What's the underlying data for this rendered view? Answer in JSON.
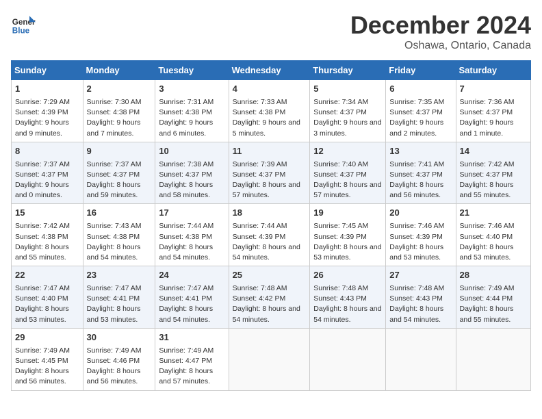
{
  "header": {
    "logo_line1": "General",
    "logo_line2": "Blue",
    "month": "December 2024",
    "location": "Oshawa, Ontario, Canada"
  },
  "weekdays": [
    "Sunday",
    "Monday",
    "Tuesday",
    "Wednesday",
    "Thursday",
    "Friday",
    "Saturday"
  ],
  "weeks": [
    [
      {
        "day": "1",
        "sunrise": "Sunrise: 7:29 AM",
        "sunset": "Sunset: 4:39 PM",
        "daylight": "Daylight: 9 hours and 9 minutes."
      },
      {
        "day": "2",
        "sunrise": "Sunrise: 7:30 AM",
        "sunset": "Sunset: 4:38 PM",
        "daylight": "Daylight: 9 hours and 7 minutes."
      },
      {
        "day": "3",
        "sunrise": "Sunrise: 7:31 AM",
        "sunset": "Sunset: 4:38 PM",
        "daylight": "Daylight: 9 hours and 6 minutes."
      },
      {
        "day": "4",
        "sunrise": "Sunrise: 7:33 AM",
        "sunset": "Sunset: 4:38 PM",
        "daylight": "Daylight: 9 hours and 5 minutes."
      },
      {
        "day": "5",
        "sunrise": "Sunrise: 7:34 AM",
        "sunset": "Sunset: 4:37 PM",
        "daylight": "Daylight: 9 hours and 3 minutes."
      },
      {
        "day": "6",
        "sunrise": "Sunrise: 7:35 AM",
        "sunset": "Sunset: 4:37 PM",
        "daylight": "Daylight: 9 hours and 2 minutes."
      },
      {
        "day": "7",
        "sunrise": "Sunrise: 7:36 AM",
        "sunset": "Sunset: 4:37 PM",
        "daylight": "Daylight: 9 hours and 1 minute."
      }
    ],
    [
      {
        "day": "8",
        "sunrise": "Sunrise: 7:37 AM",
        "sunset": "Sunset: 4:37 PM",
        "daylight": "Daylight: 9 hours and 0 minutes."
      },
      {
        "day": "9",
        "sunrise": "Sunrise: 7:37 AM",
        "sunset": "Sunset: 4:37 PM",
        "daylight": "Daylight: 8 hours and 59 minutes."
      },
      {
        "day": "10",
        "sunrise": "Sunrise: 7:38 AM",
        "sunset": "Sunset: 4:37 PM",
        "daylight": "Daylight: 8 hours and 58 minutes."
      },
      {
        "day": "11",
        "sunrise": "Sunrise: 7:39 AM",
        "sunset": "Sunset: 4:37 PM",
        "daylight": "Daylight: 8 hours and 57 minutes."
      },
      {
        "day": "12",
        "sunrise": "Sunrise: 7:40 AM",
        "sunset": "Sunset: 4:37 PM",
        "daylight": "Daylight: 8 hours and 57 minutes."
      },
      {
        "day": "13",
        "sunrise": "Sunrise: 7:41 AM",
        "sunset": "Sunset: 4:37 PM",
        "daylight": "Daylight: 8 hours and 56 minutes."
      },
      {
        "day": "14",
        "sunrise": "Sunrise: 7:42 AM",
        "sunset": "Sunset: 4:37 PM",
        "daylight": "Daylight: 8 hours and 55 minutes."
      }
    ],
    [
      {
        "day": "15",
        "sunrise": "Sunrise: 7:42 AM",
        "sunset": "Sunset: 4:38 PM",
        "daylight": "Daylight: 8 hours and 55 minutes."
      },
      {
        "day": "16",
        "sunrise": "Sunrise: 7:43 AM",
        "sunset": "Sunset: 4:38 PM",
        "daylight": "Daylight: 8 hours and 54 minutes."
      },
      {
        "day": "17",
        "sunrise": "Sunrise: 7:44 AM",
        "sunset": "Sunset: 4:38 PM",
        "daylight": "Daylight: 8 hours and 54 minutes."
      },
      {
        "day": "18",
        "sunrise": "Sunrise: 7:44 AM",
        "sunset": "Sunset: 4:39 PM",
        "daylight": "Daylight: 8 hours and 54 minutes."
      },
      {
        "day": "19",
        "sunrise": "Sunrise: 7:45 AM",
        "sunset": "Sunset: 4:39 PM",
        "daylight": "Daylight: 8 hours and 53 minutes."
      },
      {
        "day": "20",
        "sunrise": "Sunrise: 7:46 AM",
        "sunset": "Sunset: 4:39 PM",
        "daylight": "Daylight: 8 hours and 53 minutes."
      },
      {
        "day": "21",
        "sunrise": "Sunrise: 7:46 AM",
        "sunset": "Sunset: 4:40 PM",
        "daylight": "Daylight: 8 hours and 53 minutes."
      }
    ],
    [
      {
        "day": "22",
        "sunrise": "Sunrise: 7:47 AM",
        "sunset": "Sunset: 4:40 PM",
        "daylight": "Daylight: 8 hours and 53 minutes."
      },
      {
        "day": "23",
        "sunrise": "Sunrise: 7:47 AM",
        "sunset": "Sunset: 4:41 PM",
        "daylight": "Daylight: 8 hours and 53 minutes."
      },
      {
        "day": "24",
        "sunrise": "Sunrise: 7:47 AM",
        "sunset": "Sunset: 4:41 PM",
        "daylight": "Daylight: 8 hours and 54 minutes."
      },
      {
        "day": "25",
        "sunrise": "Sunrise: 7:48 AM",
        "sunset": "Sunset: 4:42 PM",
        "daylight": "Daylight: 8 hours and 54 minutes."
      },
      {
        "day": "26",
        "sunrise": "Sunrise: 7:48 AM",
        "sunset": "Sunset: 4:43 PM",
        "daylight": "Daylight: 8 hours and 54 minutes."
      },
      {
        "day": "27",
        "sunrise": "Sunrise: 7:48 AM",
        "sunset": "Sunset: 4:43 PM",
        "daylight": "Daylight: 8 hours and 54 minutes."
      },
      {
        "day": "28",
        "sunrise": "Sunrise: 7:49 AM",
        "sunset": "Sunset: 4:44 PM",
        "daylight": "Daylight: 8 hours and 55 minutes."
      }
    ],
    [
      {
        "day": "29",
        "sunrise": "Sunrise: 7:49 AM",
        "sunset": "Sunset: 4:45 PM",
        "daylight": "Daylight: 8 hours and 56 minutes."
      },
      {
        "day": "30",
        "sunrise": "Sunrise: 7:49 AM",
        "sunset": "Sunset: 4:46 PM",
        "daylight": "Daylight: 8 hours and 56 minutes."
      },
      {
        "day": "31",
        "sunrise": "Sunrise: 7:49 AM",
        "sunset": "Sunset: 4:47 PM",
        "daylight": "Daylight: 8 hours and 57 minutes."
      },
      null,
      null,
      null,
      null
    ]
  ]
}
